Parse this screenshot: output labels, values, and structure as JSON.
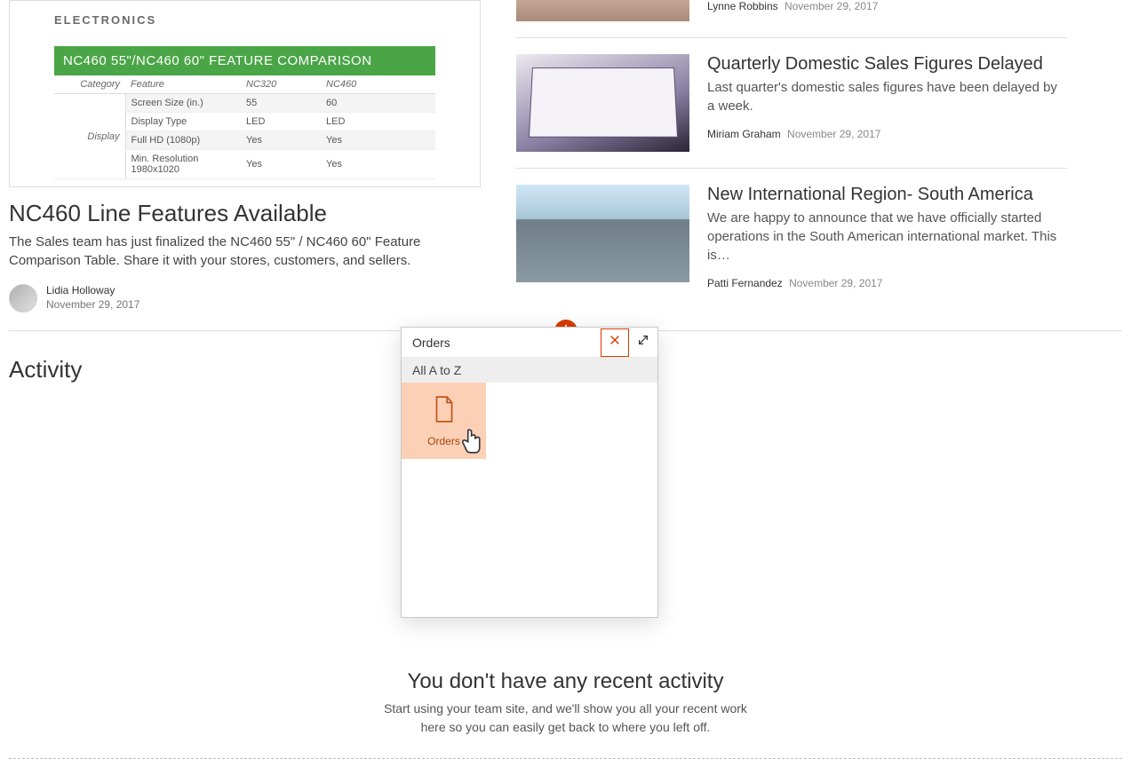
{
  "feature_card": {
    "brand_subtitle": "ELECTRONICS",
    "green_band": "NC460 55\"/NC460 60\" FEATURE COMPARISON",
    "headers": {
      "category": "Category",
      "feature": "Feature",
      "col1": "NC320",
      "col2": "NC460"
    },
    "rowhead": "Display",
    "rows": [
      {
        "feature": "Screen Size (in.)",
        "c1": "55",
        "c2": "60"
      },
      {
        "feature": "Display Type",
        "c1": "LED",
        "c2": "LED"
      },
      {
        "feature": "Full HD (1080p)",
        "c1": "Yes",
        "c2": "Yes"
      },
      {
        "feature": "Min. Resolution 1980x1020",
        "c1": "Yes",
        "c2": "Yes"
      }
    ]
  },
  "main_news": {
    "title": "NC460 Line Features Available",
    "desc": "The Sales team has just finalized the NC460 55\" / NC460 60\" Feature Comparison Table. Share it with your stores, customers, and sellers.",
    "author": "Lidia Holloway",
    "date": "November 29, 2017"
  },
  "side_news": [
    {
      "title": "",
      "desc": "",
      "author": "Lynne Robbins",
      "date": "November 29, 2017"
    },
    {
      "title": "Quarterly Domestic Sales Figures Delayed",
      "desc": "Last quarter's domestic sales figures have been delayed by a week.",
      "author": "Miriam Graham",
      "date": "November 29, 2017"
    },
    {
      "title": "New International Region- South America",
      "desc": "We are happy to announce that we have officially started operations in the South American international market. This is…",
      "author": "Patti Fernandez",
      "date": "November 29, 2017"
    }
  ],
  "activity": {
    "heading": "Activity",
    "empty_title": "You don't have any recent activity",
    "empty_desc": "Start using your team site, and we'll show you all your recent work here so you can easily get back to where you left off."
  },
  "dialog": {
    "title": "Orders",
    "filter": "All A to Z",
    "tile_label": "Orders"
  }
}
